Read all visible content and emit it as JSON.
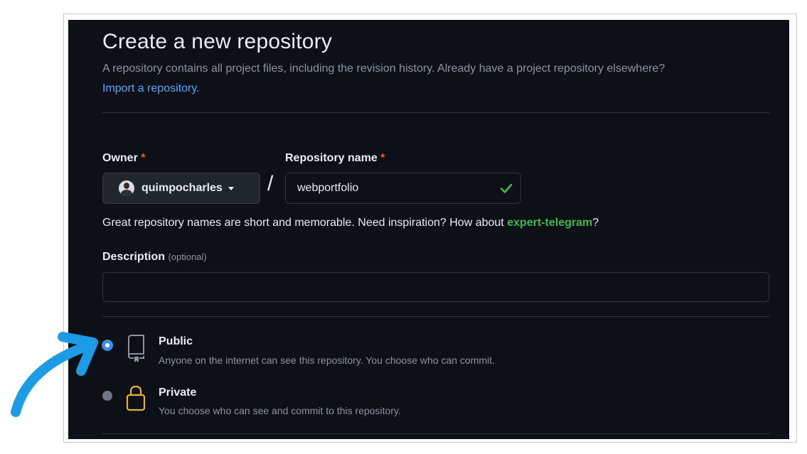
{
  "header": {
    "title": "Create a new repository",
    "subtitle": "A repository contains all project files, including the revision history. Already have a project repository elsewhere?",
    "import_link": "Import a repository."
  },
  "owner": {
    "label": "Owner",
    "required_mark": "*",
    "value": "quimpocharles"
  },
  "repo_name": {
    "label": "Repository name",
    "required_mark": "*",
    "value": "webportfolio",
    "valid": true
  },
  "separator": "/",
  "hint": {
    "text": "Great repository names are short and memorable. Need inspiration? How about ",
    "suggestion": "expert-telegram",
    "suffix": "?"
  },
  "description": {
    "label": "Description",
    "optional": "(optional)",
    "value": ""
  },
  "visibility": {
    "selected": "public",
    "public": {
      "title": "Public",
      "desc": "Anyone on the internet can see this repository. You choose who can commit.",
      "icon": "repo-icon"
    },
    "private": {
      "title": "Private",
      "desc": "You choose who can see and commit to this repository.",
      "icon": "lock-icon"
    }
  },
  "colors": {
    "background": "#0d1117",
    "link": "#58a6ff",
    "success": "#3fb950",
    "required": "#f85149",
    "radio_selected": "#3b8eea",
    "lock": "#e3b341",
    "annotation_arrow": "#1c9be6"
  }
}
